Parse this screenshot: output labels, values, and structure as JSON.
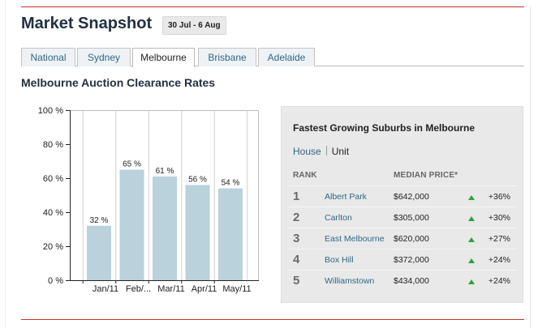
{
  "header": {
    "title": "Market Snapshot",
    "date_range": "30 Jul - 6 Aug"
  },
  "tabs": [
    {
      "label": "National",
      "active": false
    },
    {
      "label": "Sydney",
      "active": false
    },
    {
      "label": "Melbourne",
      "active": true
    },
    {
      "label": "Brisbane",
      "active": false
    },
    {
      "label": "Adelaide",
      "active": false
    }
  ],
  "section_title": "Melbourne Auction Clearance Rates",
  "chart_data": {
    "type": "bar",
    "title": "Melbourne Auction Clearance Rates",
    "categories": [
      "Jan/11",
      "Feb/...",
      "Mar/11",
      "Apr/11",
      "May/11"
    ],
    "values": [
      32,
      65,
      61,
      56,
      54
    ],
    "value_labels": [
      "32 %",
      "65 %",
      "61 %",
      "56 %",
      "54 %"
    ],
    "y_ticks": [
      "0 %",
      "20 %",
      "40 %",
      "60 %",
      "80 %",
      "100 %"
    ],
    "ylim": [
      0,
      100
    ],
    "grid": "vertical",
    "bar_color": "#b9d2db"
  },
  "panel": {
    "title": "Fastest Growing Suburbs in Melbourne",
    "toggle": {
      "house": "House",
      "unit": "Unit"
    },
    "columns": {
      "rank": "RANK",
      "price": "MEDIAN PRICE*"
    },
    "rows": [
      {
        "rank": "1",
        "suburb": "Albert Park",
        "price": "$642,000",
        "growth": "+36%"
      },
      {
        "rank": "2",
        "suburb": "Carlton",
        "price": "$305,000",
        "growth": "+30%"
      },
      {
        "rank": "3",
        "suburb": "East Melbourne",
        "price": "$620,000",
        "growth": "+27%"
      },
      {
        "rank": "4",
        "suburb": "Box Hill",
        "price": "$372,000",
        "growth": "+24%"
      },
      {
        "rank": "5",
        "suburb": "Williamstown",
        "price": "$434,000",
        "growth": "+24%"
      }
    ],
    "up_color": "#2ea33a"
  }
}
